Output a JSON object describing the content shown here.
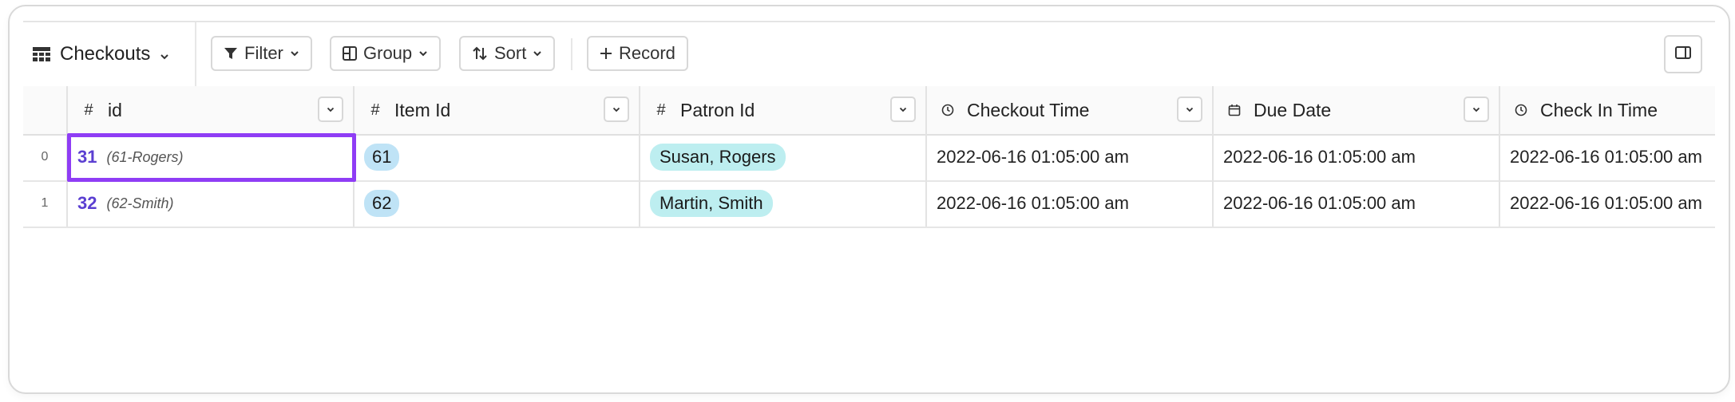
{
  "toolbar": {
    "table_name": "Checkouts",
    "filter_label": "Filter",
    "group_label": "Group",
    "sort_label": "Sort",
    "record_label": "Record"
  },
  "columns": [
    {
      "icon": "#",
      "label": "id"
    },
    {
      "icon": "#",
      "label": "Item Id"
    },
    {
      "icon": "#",
      "label": "Patron Id"
    },
    {
      "icon": "clock-icon",
      "label": "Checkout Time"
    },
    {
      "icon": "calendar-icon",
      "label": "Due Date"
    },
    {
      "icon": "clock-icon",
      "label": "Check In Time"
    }
  ],
  "rows": [
    {
      "index": "0",
      "id": "31",
      "id_ref": "(61-Rogers)",
      "item_id": "61",
      "patron": "Susan, Rogers",
      "checkout_time": "2022-06-16 01:05:00 am",
      "due_date": "2022-06-16 01:05:00 am",
      "check_in_time": "2022-06-16 01:05:00 am"
    },
    {
      "index": "1",
      "id": "32",
      "id_ref": "(62-Smith)",
      "item_id": "62",
      "patron": "Martin, Smith",
      "checkout_time": "2022-06-16 01:05:00 am",
      "due_date": "2022-06-16 01:05:00 am",
      "check_in_time": "2022-06-16 01:05:00 am"
    }
  ],
  "colors": {
    "accent": "#5b3fd1",
    "selection": "#8f3df5",
    "pill_blue": "#bfe3f6",
    "pill_teal": "#bdeef0"
  }
}
